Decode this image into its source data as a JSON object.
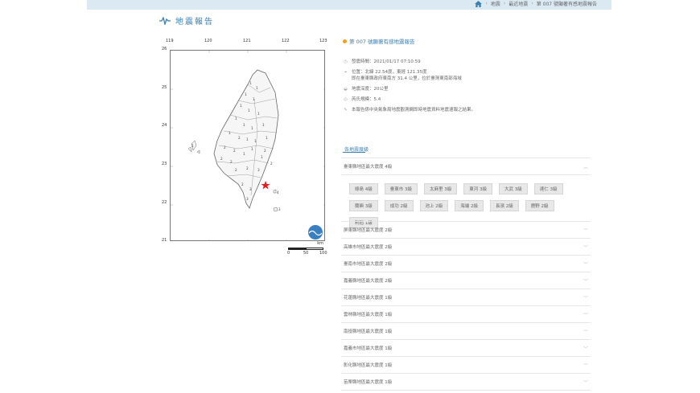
{
  "breadcrumb": {
    "items": [
      "地震",
      "最近地震",
      "第 007 號顯著有感地震報告"
    ]
  },
  "page": {
    "title": "地震報告"
  },
  "report": {
    "title": "第 007 號顯著有感地震報告",
    "time": "發震時間：2021/01/17 07:10:59",
    "location_line1": "位置：北緯 22.54度，東經 121.35度",
    "location_line2": "即在臺東縣政府東南方 31.4 公里，位於臺灣東南部海域",
    "depth": "地震深度：20公里",
    "magnitude": "芮氏規模：5.4",
    "note": "本報告係中央氣象局地震觀測網即時地震資料地震速報之結果。"
  },
  "map": {
    "lon_ticks": [
      "119",
      "120",
      "121",
      "122",
      "123"
    ],
    "lat_ticks": [
      "26",
      "25",
      "24",
      "23",
      "22",
      "21"
    ],
    "scale_labels": [
      "0",
      "50",
      "100"
    ],
    "scale_unit": "km",
    "epicenter_color": "#e02020",
    "logo_color": "#3a7fc0"
  },
  "intensity": {
    "section_title": "各地震度級",
    "expanded": {
      "label": "臺東縣地區最大震度 4級",
      "stations": [
        "綠島 4級",
        "臺東市 3級",
        "太麻里 3級",
        "東河 3級",
        "大武 3級",
        "達仁 3級",
        "蘭嶼 3級",
        "成功 2級",
        "池上 2級",
        "海端 2級",
        "長濱 2級",
        "鹿野 2級",
        "利稻 1級"
      ]
    },
    "regions": [
      "屏東縣地區最大震度 2級",
      "高雄市地區最大震度 2級",
      "臺南市地區最大震度 2級",
      "嘉義縣地區最大震度 2級",
      "花蓮縣地區最大震度 1級",
      "雲林縣地區最大震度 1級",
      "南投縣地區最大震度 1級",
      "嘉義市地區最大震度 1級",
      "彰化縣地區最大震度 1級",
      "苗栗縣地區最大震度 1級"
    ]
  }
}
